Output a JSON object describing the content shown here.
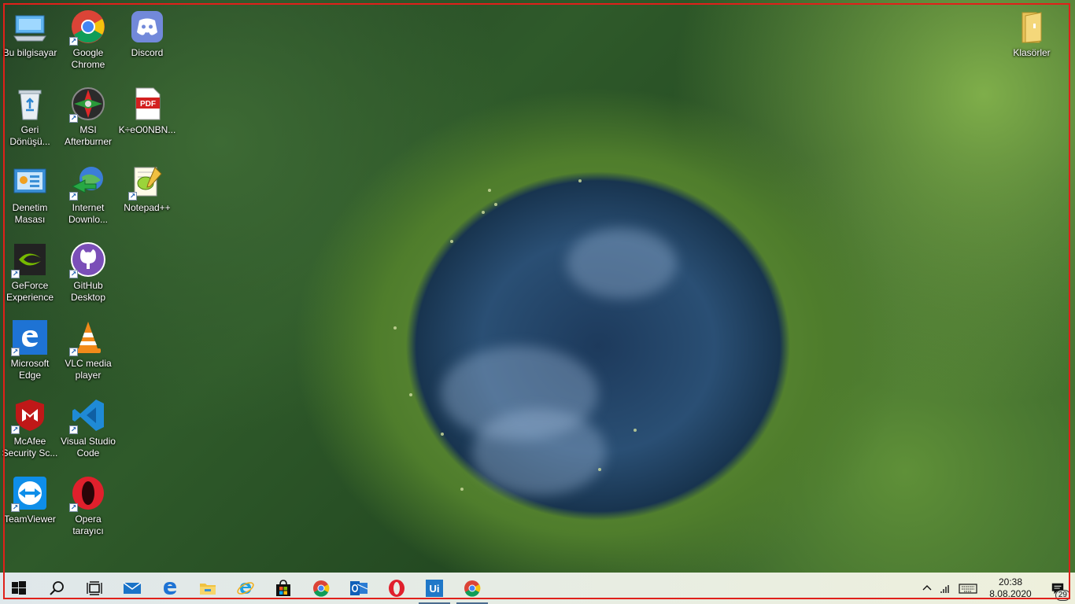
{
  "desktop_icons": [
    {
      "label": "Bu bilgisayar",
      "icon": "this-pc-icon"
    },
    {
      "label": "Google\nChrome",
      "icon": "chrome-icon"
    },
    {
      "label": "Discord",
      "icon": "discord-icon"
    },
    {
      "label": "Geri\nDönüşü...",
      "icon": "recycle-bin-icon"
    },
    {
      "label": "MSI\nAfterburner",
      "icon": "msi-afterburner-icon"
    },
    {
      "label": "K÷eO0NBN...",
      "icon": "pdf-icon"
    },
    {
      "label": "Denetim\nMasası",
      "icon": "control-panel-icon"
    },
    {
      "label": "Internet\nDownlo...",
      "icon": "internet-download-manager-icon"
    },
    {
      "label": "Notepad++",
      "icon": "notepad-plus-plus-icon"
    },
    {
      "label": "GeForce\nExperience",
      "icon": "geforce-experience-icon"
    },
    {
      "label": "GitHub\nDesktop",
      "icon": "github-desktop-icon"
    },
    {
      "label": "Microsoft\nEdge",
      "icon": "edge-legacy-icon"
    },
    {
      "label": "VLC media\nplayer",
      "icon": "vlc-icon"
    },
    {
      "label": "McAfee\nSecurity Sc...",
      "icon": "mcafee-icon"
    },
    {
      "label": "Visual Studio\nCode",
      "icon": "vscode-icon"
    },
    {
      "label": "TeamViewer",
      "icon": "teamviewer-icon"
    },
    {
      "label": "Opera\ntarayıcı",
      "icon": "opera-icon"
    },
    {
      "label": "Klasörler",
      "icon": "folder-icon"
    }
  ],
  "taskbar": {
    "apps": [
      {
        "name": "start-button",
        "icon": "windows-logo-icon"
      },
      {
        "name": "search-button",
        "icon": "search-icon"
      },
      {
        "name": "task-view-button",
        "icon": "task-view-icon"
      },
      {
        "name": "taskbar-mail",
        "icon": "mail-icon"
      },
      {
        "name": "taskbar-edge",
        "icon": "edge-icon"
      },
      {
        "name": "taskbar-file-explorer",
        "icon": "file-explorer-icon"
      },
      {
        "name": "taskbar-internet-explorer",
        "icon": "internet-explorer-icon"
      },
      {
        "name": "taskbar-store",
        "icon": "store-icon"
      },
      {
        "name": "taskbar-chrome",
        "icon": "chrome-icon"
      },
      {
        "name": "taskbar-outlook",
        "icon": "outlook-icon"
      },
      {
        "name": "taskbar-opera",
        "icon": "opera-icon"
      },
      {
        "name": "taskbar-uipath",
        "icon": "uipath-icon",
        "text": "Ui"
      },
      {
        "name": "taskbar-chrome-2",
        "icon": "chrome-icon"
      }
    ],
    "clock_time": "20:38",
    "clock_date": "8.08.2020",
    "notification_count": "29"
  },
  "colors": {
    "frame": "#e0201a",
    "taskbar_bg": "#e6ece4"
  }
}
